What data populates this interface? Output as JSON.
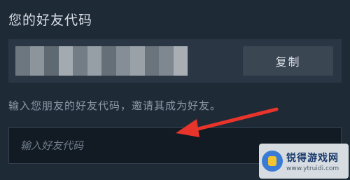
{
  "section": {
    "title": "您的好友代码",
    "copy_label": "复制",
    "hint": "输入您朋友的好友代码，邀请其成为好友。",
    "input_placeholder": "输入好友代码"
  },
  "code_blur_colors": [
    "#6d7780",
    "#8c959c",
    "#5e6972",
    "#a3aab0",
    "#737d86",
    "#969fa6",
    "#656f78",
    "#858e96",
    "#9aa2a8",
    "#6a747d",
    "#7f8890",
    "#a8aeb3"
  ],
  "annotation": {
    "arrow_color": "#e8342b"
  },
  "watermark": {
    "name": "锐得游戏网",
    "url": "www.ytruidi.com"
  }
}
